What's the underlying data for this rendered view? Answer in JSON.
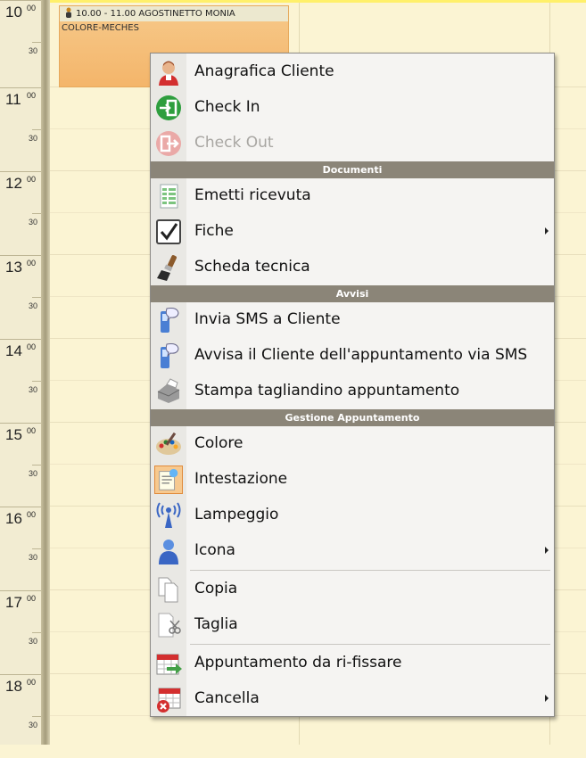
{
  "colors": {
    "background": "#fbf4d3",
    "appointment": "#f4b56a",
    "section_header": "#8b8578",
    "menu_bg": "#f5f4f2"
  },
  "schedule": {
    "hours": [
      {
        "h": "10",
        "m": "00",
        "half": "30"
      },
      {
        "h": "11",
        "m": "00",
        "half": "30"
      },
      {
        "h": "12",
        "m": "00",
        "half": "30"
      },
      {
        "h": "13",
        "m": "00",
        "half": "30"
      },
      {
        "h": "14",
        "m": "00",
        "half": "30"
      },
      {
        "h": "15",
        "m": "00",
        "half": "30"
      },
      {
        "h": "16",
        "m": "00",
        "half": "30"
      },
      {
        "h": "17",
        "m": "00",
        "half": "30"
      },
      {
        "h": "18",
        "m": "00",
        "half": "30"
      }
    ]
  },
  "appointment": {
    "header": "10.00 - 11.00 AGOSTINETTO  MONIA",
    "service": "COLORE-MECHES",
    "icon": "person-icon"
  },
  "menu": {
    "items": [
      {
        "label": "Anagrafica Cliente",
        "icon": "client-card-icon"
      },
      {
        "label": "Check In",
        "icon": "check-in-icon"
      },
      {
        "label": "Check Out",
        "icon": "check-out-icon"
      },
      {
        "label": "Emetti ricevuta",
        "icon": "receipt-icon"
      },
      {
        "label": "Fiche",
        "icon": "checkbox-icon"
      },
      {
        "label": "Scheda tecnica",
        "icon": "brush-icon"
      },
      {
        "label": "Invia SMS a Cliente",
        "icon": "sms-phone-icon"
      },
      {
        "label": "Avvisa il Cliente dell'appuntamento via SMS",
        "icon": "sms-notify-icon"
      },
      {
        "label": "Stampa tagliandino appuntamento",
        "icon": "printer-icon"
      },
      {
        "label": "Colore",
        "icon": "palette-icon"
      },
      {
        "label": "Intestazione",
        "icon": "header-note-icon"
      },
      {
        "label": "Lampeggio",
        "icon": "blink-antenna-icon"
      },
      {
        "label": "Icona",
        "icon": "person-icon"
      },
      {
        "label": "Copia",
        "icon": "copy-icon"
      },
      {
        "label": "Taglia",
        "icon": "cut-icon"
      },
      {
        "label": "Appuntamento da ri-fissare",
        "icon": "calendar-reschedule-icon"
      },
      {
        "label": "Cancella",
        "icon": "calendar-delete-icon"
      }
    ],
    "sections": {
      "documenti": "Documenti",
      "avvisi": "Avvisi",
      "gestione": "Gestione Appuntamento"
    }
  }
}
